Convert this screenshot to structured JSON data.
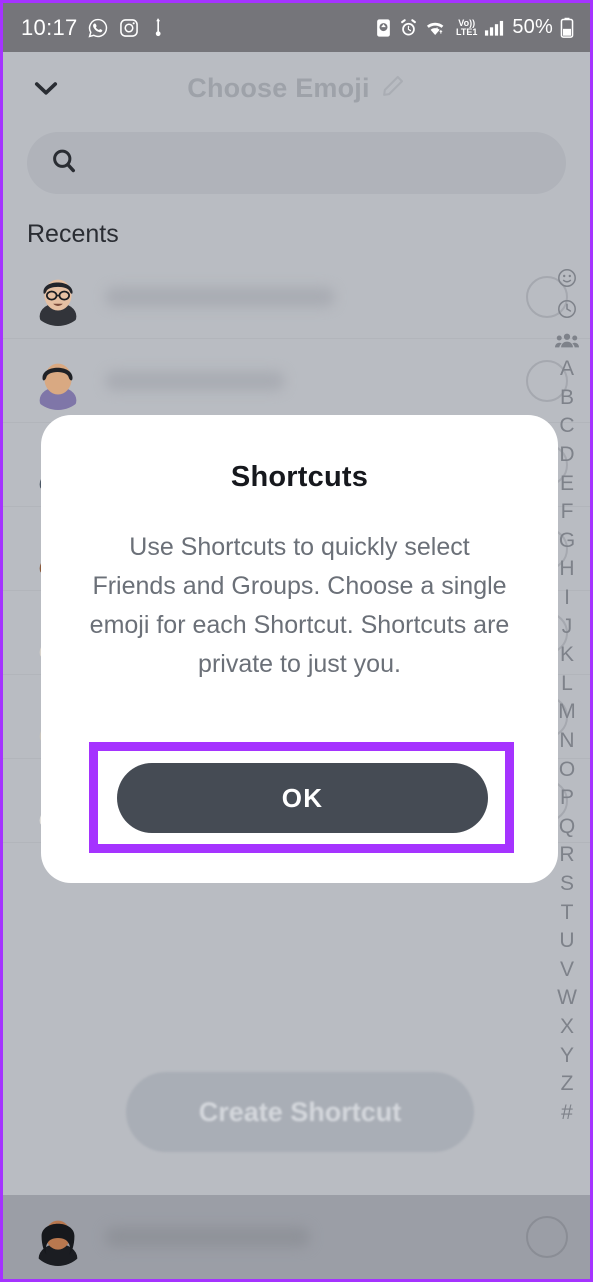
{
  "status_bar": {
    "time": "10:17",
    "left_icons": [
      "whatsapp-icon",
      "instagram-icon",
      "usb-icon"
    ],
    "right_icons": [
      "screen-record-icon",
      "alarm-icon",
      "wifi-icon"
    ],
    "network_line1": "Vo))",
    "network_line2": "LTE1",
    "signal_icon": "signal-bars-icon",
    "battery_percent": "50%",
    "battery_icon": "battery-icon"
  },
  "header": {
    "back_icon": "chevron-down-icon",
    "title": "Choose Emoji",
    "edit_icon": "pencil-icon"
  },
  "search": {
    "icon": "search-icon",
    "value": "",
    "placeholder": ""
  },
  "list": {
    "section_title": "Recents",
    "rows": [
      {
        "avatar": "bitmoji-glasses-dark-shirt",
        "name": "",
        "select_state": "unselected"
      },
      {
        "avatar": "bitmoji-purple-hood",
        "name": "",
        "select_state": "unselected"
      },
      {
        "avatar": "bitmoji-curly-hair",
        "name": "",
        "select_state": "unselected"
      },
      {
        "avatar": "bitmoji-glasses-brown-shirt",
        "name": "",
        "select_state": "unselected"
      },
      {
        "avatar": "bitmoji-beard-bun",
        "name": "",
        "select_state": "unselected"
      },
      {
        "avatar": "bitmoji-long-hair",
        "name": "",
        "select_state": "unselected"
      },
      {
        "avatar": "bitmoji-beard-cap",
        "name": "",
        "select_state": "unselected"
      },
      {
        "avatar": "bitmoji-woman-dark-hair",
        "name": "",
        "select_state": "unselected"
      }
    ]
  },
  "index_bar": {
    "icons": [
      "emoji-smiley-icon",
      "clock-icon",
      "group-icon"
    ],
    "letters": [
      "A",
      "B",
      "C",
      "D",
      "E",
      "F",
      "G",
      "H",
      "I",
      "J",
      "K",
      "L",
      "M",
      "N",
      "O",
      "P",
      "Q",
      "R",
      "S",
      "T",
      "U",
      "V",
      "W",
      "X",
      "Y",
      "Z",
      "#"
    ]
  },
  "fab": {
    "label": "Create Shortcut"
  },
  "modal": {
    "title": "Shortcuts",
    "body": "Use Shortcuts to quickly select Friends and Groups. Choose a single emoji for each Shortcut. Shortcuts are private to just you.",
    "ok_label": "OK"
  },
  "colors": {
    "highlight": "#a533ff",
    "ok_button": "#454b54",
    "modal_bg": "#ffffff",
    "app_bg": "#b9bcc2",
    "status_bar_bg": "#75757a",
    "body_text": "#6b7078"
  }
}
